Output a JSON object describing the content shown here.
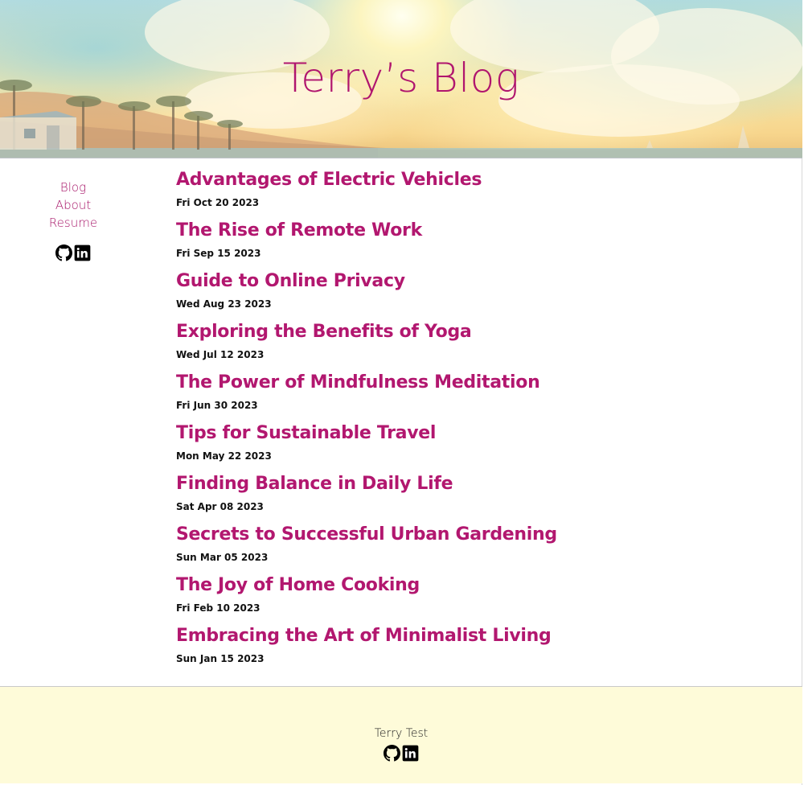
{
  "header": {
    "title": "Terry’s Blog"
  },
  "sidebar": {
    "nav": [
      {
        "label": "Blog"
      },
      {
        "label": "About"
      },
      {
        "label": "Resume"
      }
    ],
    "social": [
      "github-icon",
      "linkedin-icon"
    ]
  },
  "posts": [
    {
      "title": "Advantages of Electric Vehicles",
      "date": "Fri Oct 20 2023"
    },
    {
      "title": "The Rise of Remote Work",
      "date": "Fri Sep 15 2023"
    },
    {
      "title": "Guide to Online Privacy",
      "date": "Wed Aug 23 2023"
    },
    {
      "title": "Exploring the Benefits of Yoga",
      "date": "Wed Jul 12 2023"
    },
    {
      "title": "The Power of Mindfulness Meditation",
      "date": "Fri Jun 30 2023"
    },
    {
      "title": "Tips for Sustainable Travel",
      "date": "Mon May 22 2023"
    },
    {
      "title": "Finding Balance in Daily Life",
      "date": "Sat Apr 08 2023"
    },
    {
      "title": "Secrets to Successful Urban Gardening",
      "date": "Sun Mar 05 2023"
    },
    {
      "title": "The Joy of Home Cooking",
      "date": "Fri Feb 10 2023"
    },
    {
      "title": "Embracing the Art of Minimalist Living",
      "date": "Sun Jan 15 2023"
    }
  ],
  "footer": {
    "name": "Terry Test",
    "social": [
      "github-icon",
      "linkedin-icon"
    ]
  },
  "colors": {
    "accent": "#b0156e",
    "footer_bg": "#fefbd9"
  }
}
